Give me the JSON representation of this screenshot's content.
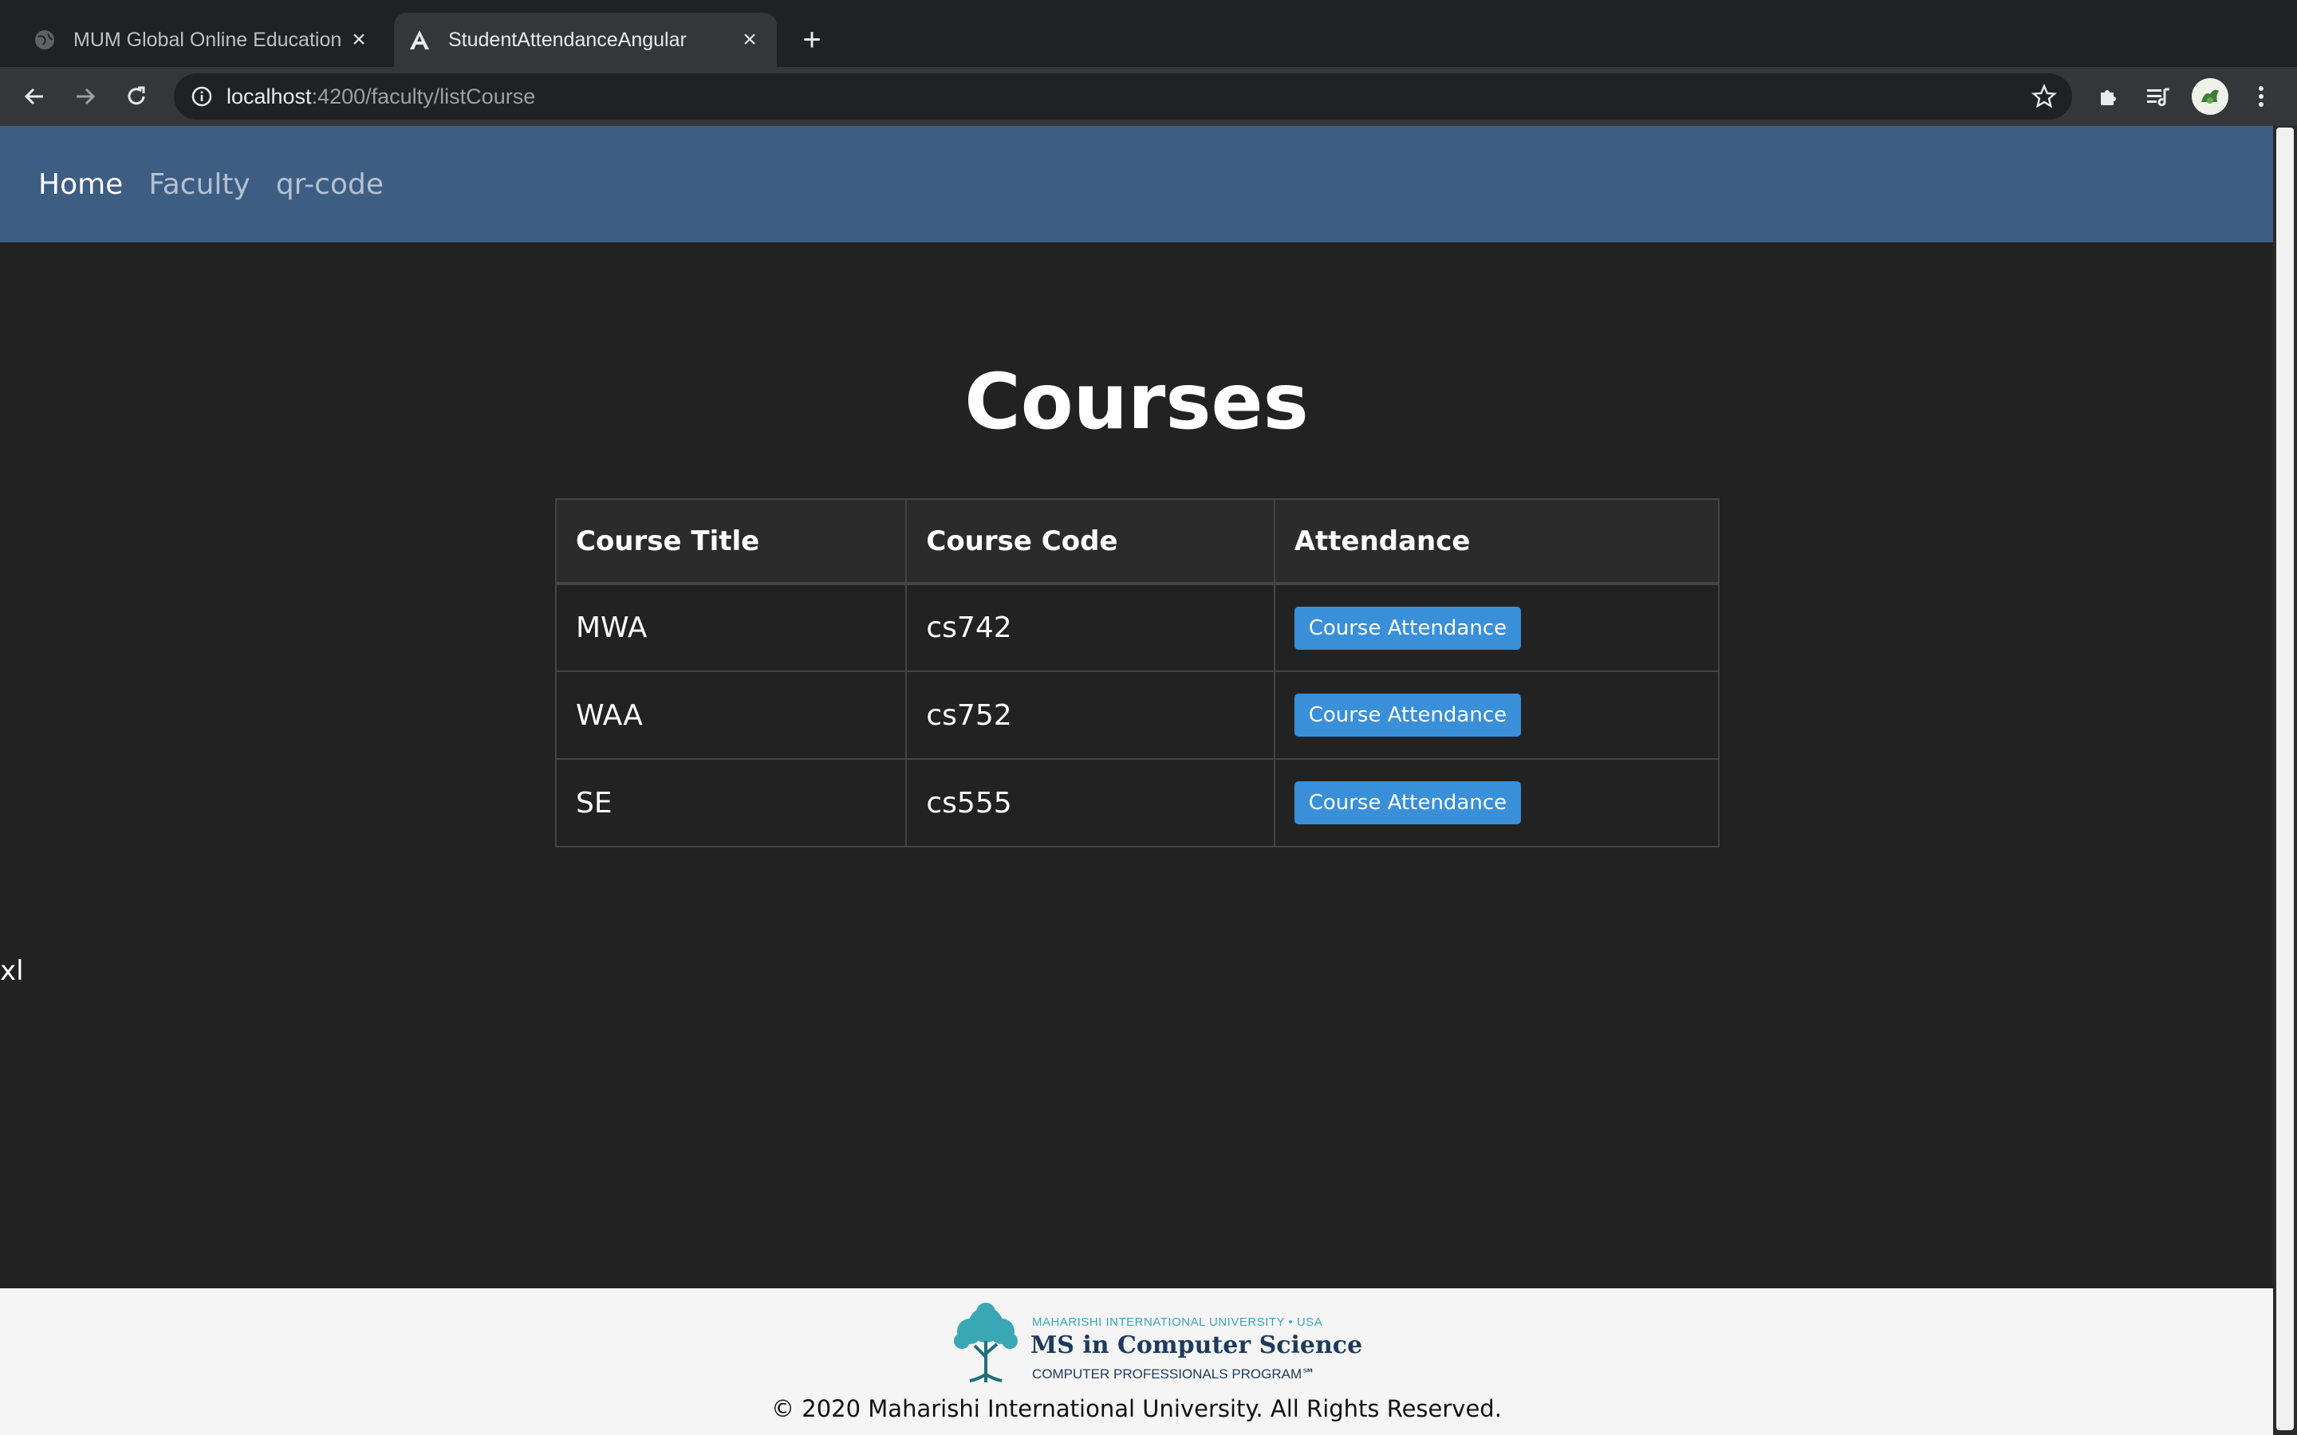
{
  "browser": {
    "tabs": [
      {
        "title": "MUM Global Online Education",
        "favicon": "globe-icon",
        "active": false
      },
      {
        "title": "StudentAttendanceAngular",
        "favicon": "angular-icon",
        "active": true
      }
    ],
    "url_host": "localhost",
    "url_path": ":4200/faculty/listCourse"
  },
  "nav": {
    "links": [
      "Home",
      "Faculty",
      "qr-code"
    ]
  },
  "page": {
    "heading": "Courses",
    "stray_text": "xl"
  },
  "table": {
    "headers": [
      "Course Title",
      "Course Code",
      "Attendance"
    ],
    "rows": [
      {
        "title": "MWA",
        "code": "cs742",
        "action": "Course Attendance"
      },
      {
        "title": "WAA",
        "code": "cs752",
        "action": "Course Attendance"
      },
      {
        "title": "SE",
        "code": "cs555",
        "action": "Course Attendance"
      }
    ]
  },
  "footer": {
    "logo_line1": "MAHARISHI INTERNATIONAL UNIVERSITY • USA",
    "logo_line2": "MS in Computer Science",
    "logo_line3": "COMPUTER PROFESSIONALS PROGRAM℠",
    "copyright": "© 2020 Maharishi International University. All Rights Reserved."
  },
  "colors": {
    "navbar": "#3e5d82",
    "page_bg": "#222222",
    "button": "#3a8fd9",
    "footer_bg": "#f5f5f5"
  }
}
